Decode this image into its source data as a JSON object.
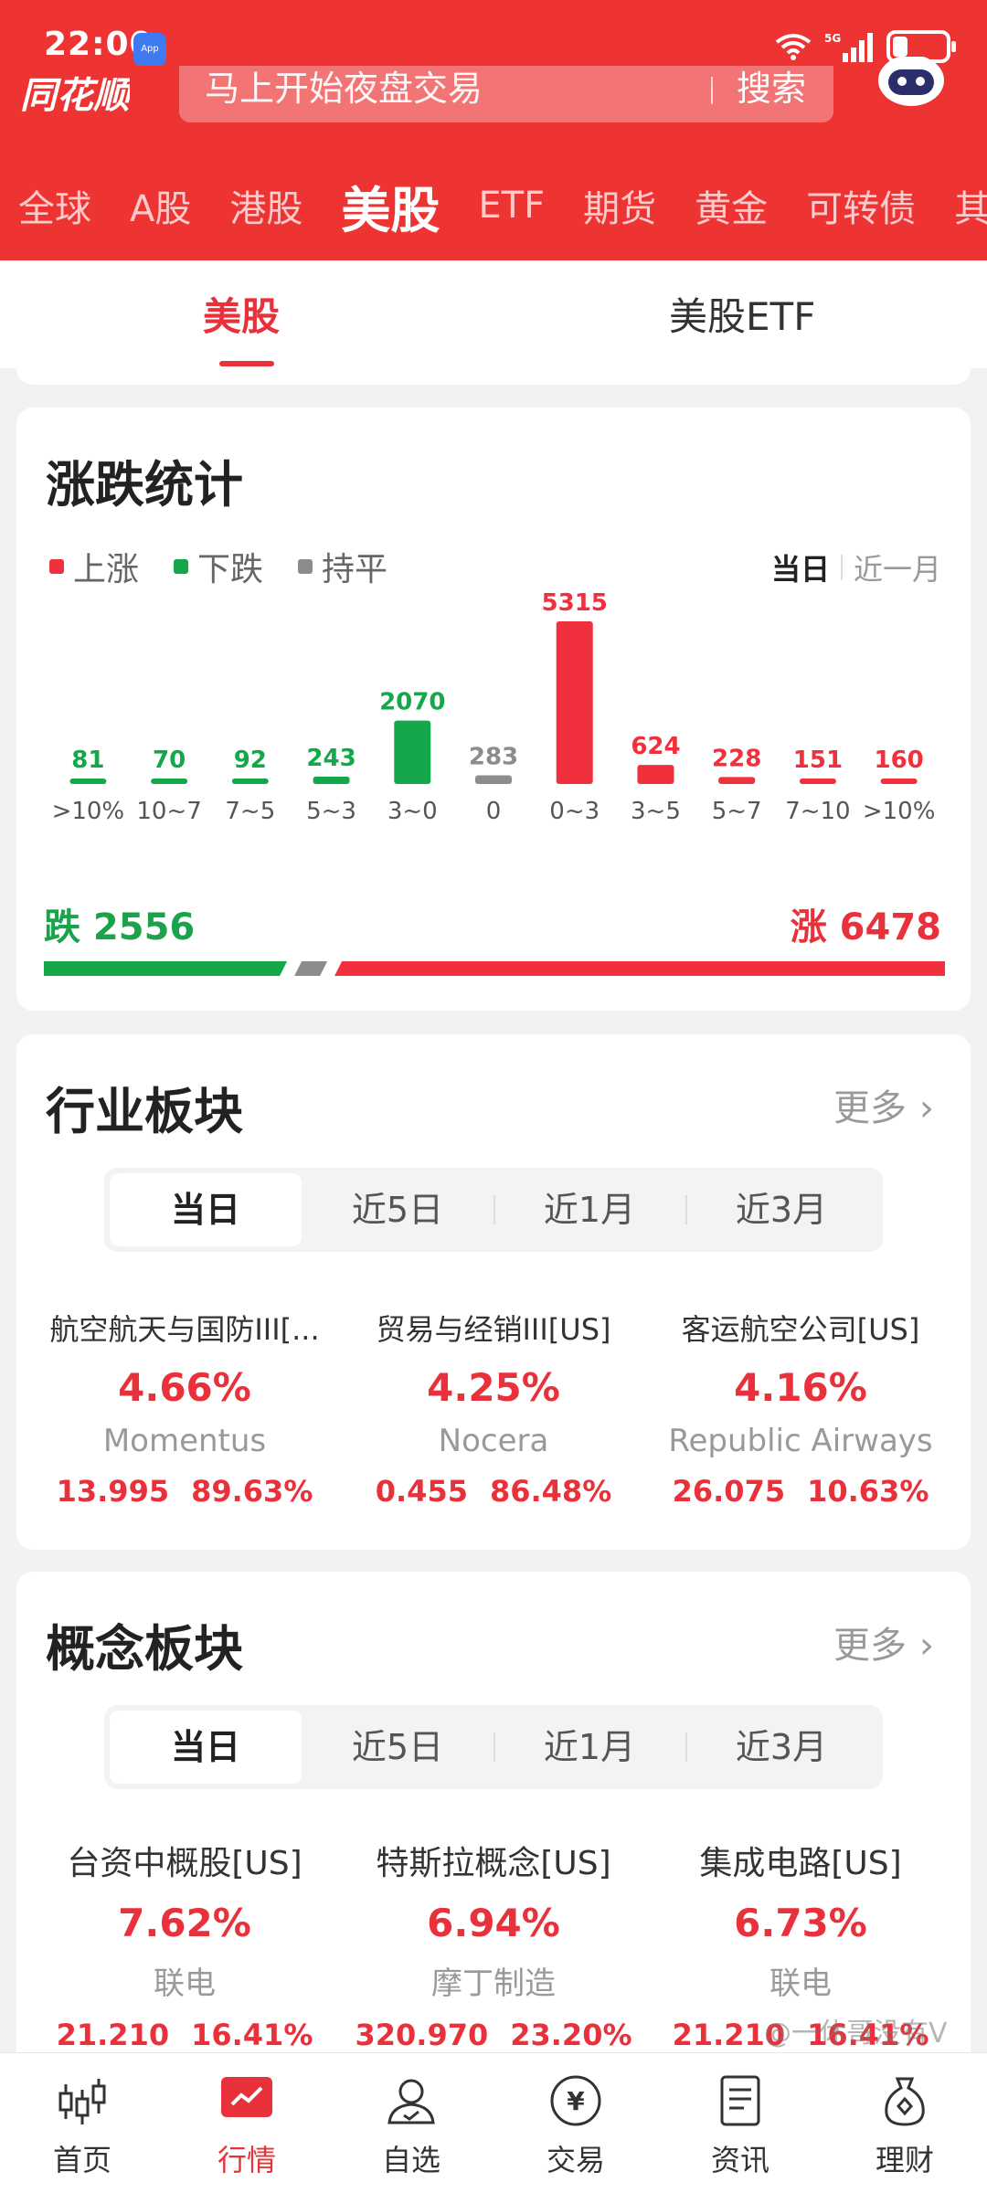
{
  "status_bar": {
    "time": "22:00",
    "app_badge": "App Market",
    "network": "5G"
  },
  "header": {
    "logo_text": "同花顺",
    "search_placeholder": "马上开始夜盘交易",
    "search_button": "搜索",
    "market_tabs": [
      "全球",
      "A股",
      "港股",
      "美股",
      "ETF",
      "期货",
      "黄金",
      "可转债",
      "其"
    ],
    "active_tab": "美股"
  },
  "subtabs": {
    "tabs": [
      "美股",
      "美股ETF"
    ],
    "active": "美股"
  },
  "stats_card": {
    "title": "涨跌统计",
    "legend": [
      "上涨",
      "下跌",
      "持平"
    ],
    "period_active": "当日",
    "period_inactive": "近一月",
    "summary_fall": "跌 2556",
    "summary_rise": "涨 6478",
    "colors": {
      "up": "#f0303c",
      "down": "#14a84a",
      "flat": "#8c8c8c"
    }
  },
  "chart_data": {
    "type": "bar",
    "categories": [
      ">10%",
      "10~7",
      "7~5",
      "5~3",
      "3~0",
      "0",
      "0~3",
      "3~5",
      "5~7",
      "7~10",
      ">10%"
    ],
    "values": [
      81,
      70,
      92,
      243,
      2070,
      283,
      5315,
      624,
      228,
      151,
      160
    ],
    "directions": [
      "down",
      "down",
      "down",
      "down",
      "down",
      "flat",
      "up",
      "up",
      "up",
      "up",
      "up"
    ],
    "totals": {
      "down": 2556,
      "up": 6478,
      "flat": 283
    }
  },
  "industry_card": {
    "title": "行业板块",
    "more": "更多",
    "periods": [
      "当日",
      "近5日",
      "近1月",
      "近3月"
    ],
    "active_period": "当日",
    "items": [
      {
        "name": "航空航天与国防III[...",
        "change": "4.66%",
        "stock": "Momentus",
        "price": "13.995",
        "stock_change": "89.63%"
      },
      {
        "name": "贸易与经销III[US]",
        "change": "4.25%",
        "stock": "Nocera",
        "price": "0.455",
        "stock_change": "86.48%"
      },
      {
        "name": "客运航空公司[US]",
        "change": "4.16%",
        "stock": "Republic Airways",
        "price": "26.075",
        "stock_change": "10.63%"
      }
    ]
  },
  "concept_card": {
    "title": "概念板块",
    "more": "更多",
    "periods": [
      "当日",
      "近5日",
      "近1月",
      "近3月"
    ],
    "active_period": "当日",
    "items": [
      {
        "name": "台资中概股[US]",
        "change": "7.62%",
        "stock": "联电",
        "price": "21.210",
        "stock_change": "16.41%"
      },
      {
        "name": "特斯拉概念[US]",
        "change": "6.94%",
        "stock": "摩丁制造",
        "price": "320.970",
        "stock_change": "23.20%"
      },
      {
        "name": "集成电路[US]",
        "change": "6.73%",
        "stock": "联电",
        "price": "21.210",
        "stock_change": "16.41%"
      }
    ]
  },
  "bottom_nav": {
    "items": [
      "首页",
      "行情",
      "自选",
      "交易",
      "资讯",
      "理财"
    ],
    "active": "行情"
  },
  "watermark": "@一休哥没有V"
}
